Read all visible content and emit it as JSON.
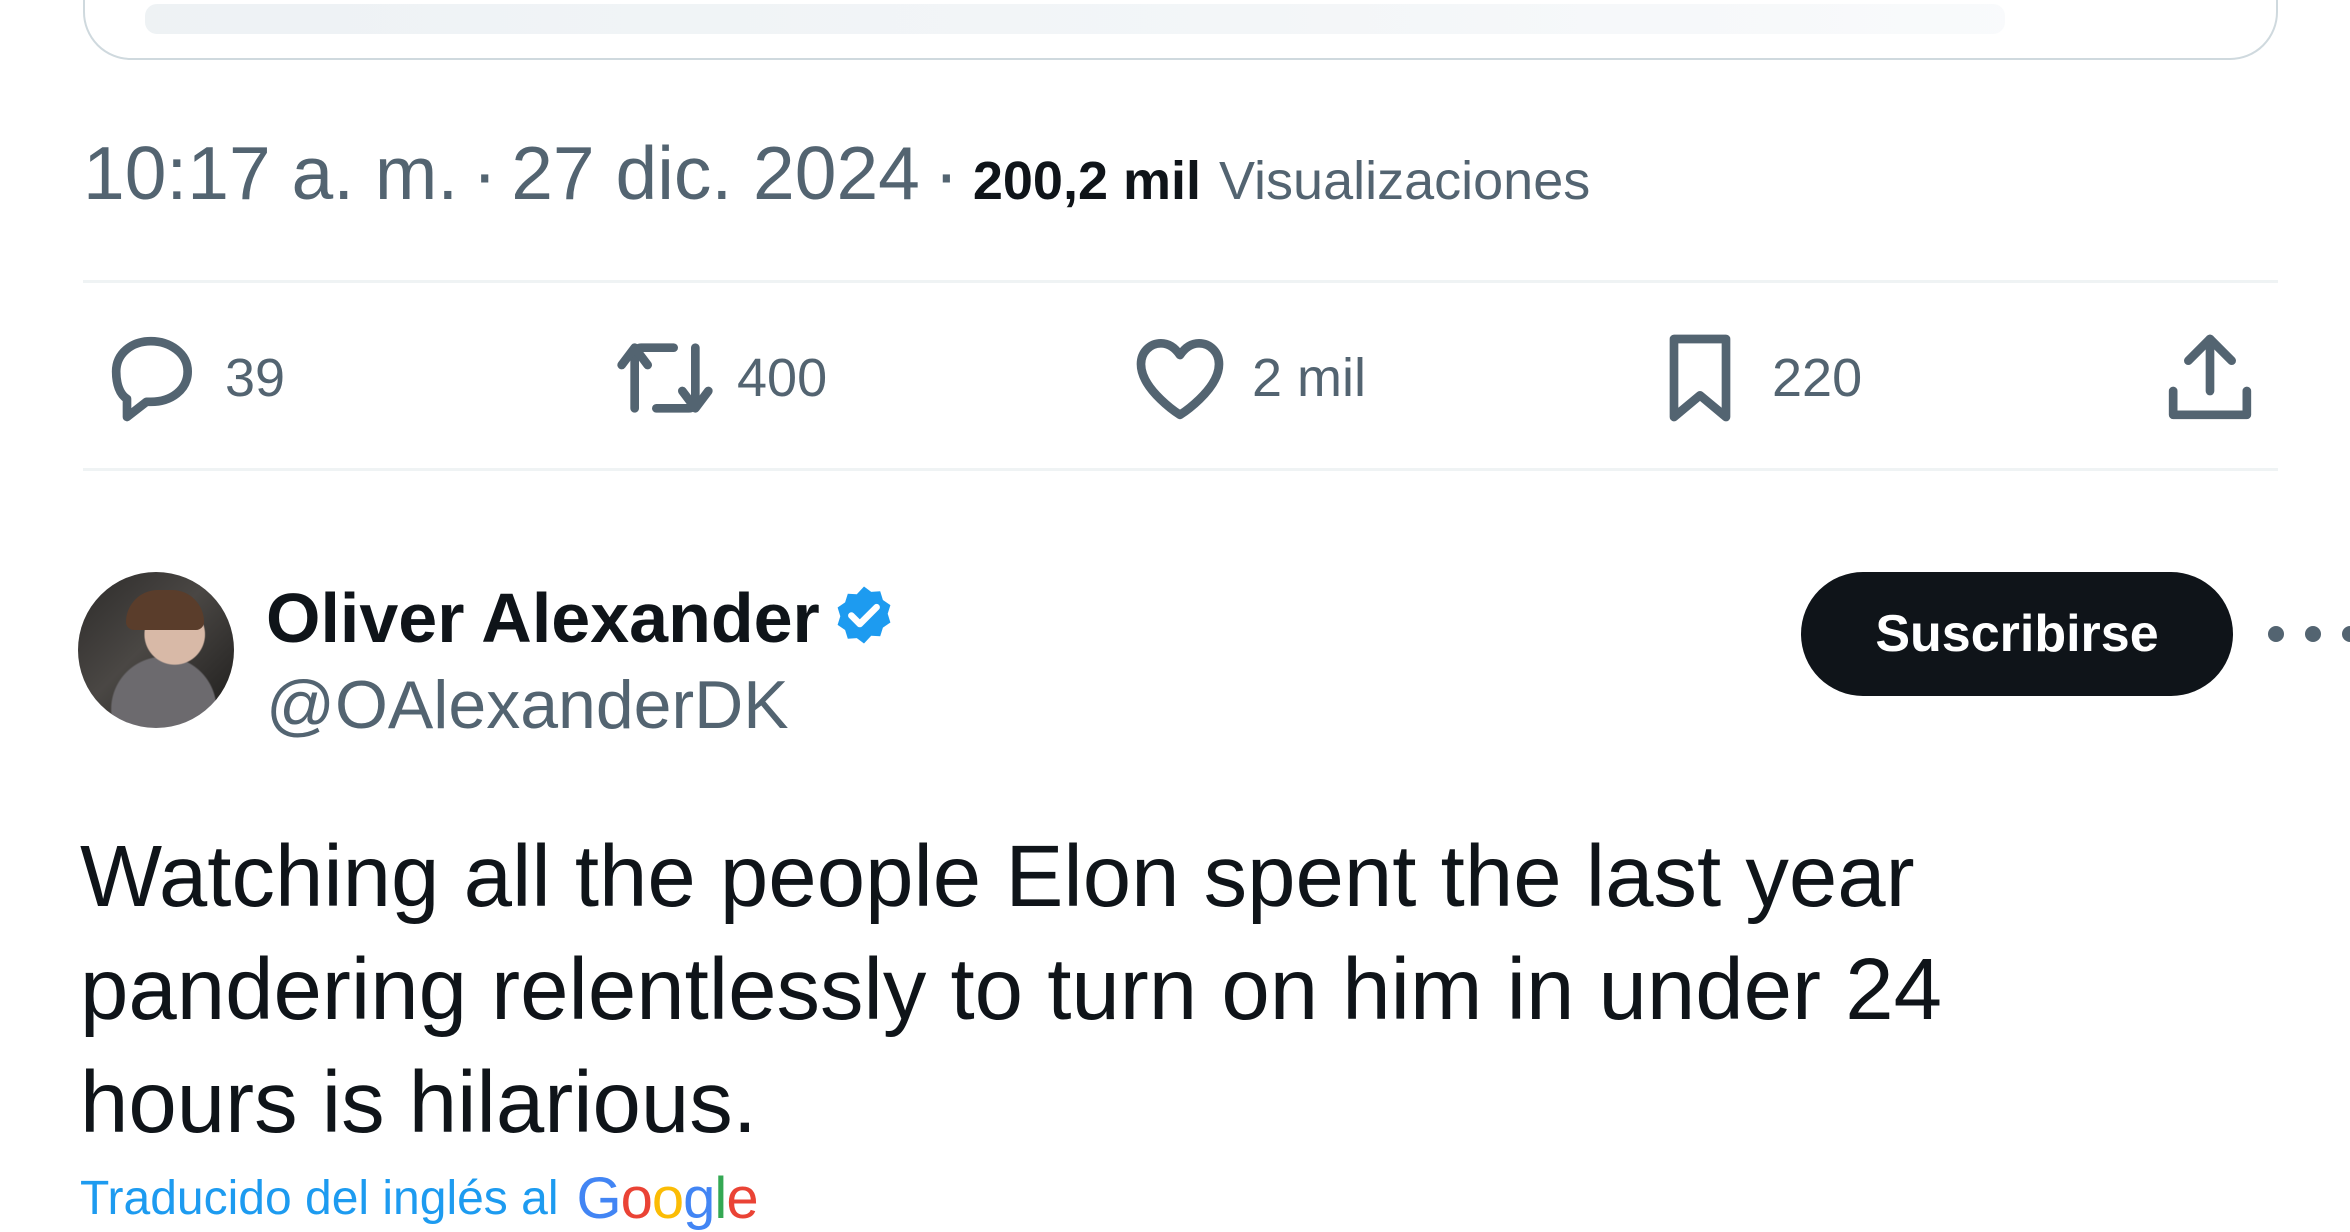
{
  "tweet_meta": {
    "time": "10:17 a. m.",
    "separator": "·",
    "date": "27 dic. 2024",
    "views_count": "200,2 mil",
    "views_label": "Visualizaciones"
  },
  "actions": {
    "replies": "39",
    "retweets": "400",
    "likes": "2 mil",
    "bookmarks": "220"
  },
  "reply_tweet": {
    "author_name": "Oliver Alexander",
    "handle": "@OAlexanderDK",
    "subscribe_label": "Suscribirse",
    "text_lines": [
      "Watching all the people Elon spent the last year",
      "pandering relentlessly to turn on him in under 24",
      "hours is hilarious."
    ],
    "translation_label": "Traducido del inglés al",
    "translation_brand": [
      "G",
      "o",
      "o",
      "g",
      "l",
      "e"
    ]
  },
  "icons": [
    "reply-icon",
    "retweet-icon",
    "like-icon",
    "bookmark-icon",
    "share-icon",
    "verified-badge-icon",
    "more-icon"
  ],
  "colors": {
    "text_primary": "#0f1419",
    "text_secondary": "#536471",
    "accent_blue": "#1d9bf0",
    "button_dark": "#0f1419"
  }
}
